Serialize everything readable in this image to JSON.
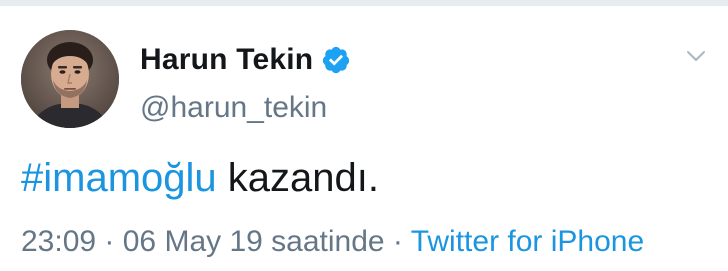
{
  "tweet": {
    "display_name": "Harun Tekin",
    "username": "@harun_tekin",
    "verified": true,
    "text": {
      "hashtag": "#imamoğlu",
      "rest": " kazandı."
    },
    "meta": {
      "time": "23:09",
      "separator_1": " · ",
      "date": "06 May 19 saatinde",
      "separator_2": " · ",
      "source": "Twitter for iPhone"
    }
  },
  "icons": {
    "verified": "verified-badge-icon",
    "menu": "chevron-down-icon"
  },
  "colors": {
    "link_blue": "#1b95e0",
    "verified_blue": "#1da1f2",
    "text_dark": "#14171a",
    "text_gray": "#657786"
  }
}
